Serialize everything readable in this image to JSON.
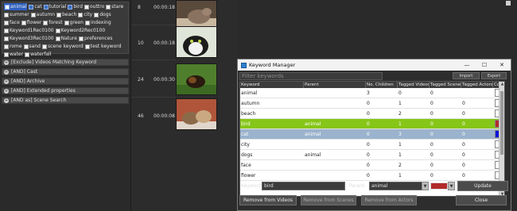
{
  "tags": [
    {
      "label": "animal",
      "checked": true,
      "highlight": true
    },
    {
      "label": "cat",
      "checked": true,
      "highlight": false
    },
    {
      "label": "tutorial",
      "checked": true,
      "highlight": false
    },
    {
      "label": "bird",
      "checked": true,
      "highlight": false
    },
    {
      "label": "outtro",
      "checked": false,
      "highlight": false
    },
    {
      "label": "stare",
      "checked": false,
      "highlight": false
    },
    {
      "label": "summer",
      "checked": false,
      "highlight": false
    },
    {
      "label": "autumn",
      "checked": false,
      "highlight": false
    },
    {
      "label": "beach",
      "checked": false,
      "highlight": false
    },
    {
      "label": "city",
      "checked": false,
      "highlight": false
    },
    {
      "label": "dogs",
      "checked": false,
      "highlight": false
    },
    {
      "label": "face",
      "checked": false,
      "highlight": false
    },
    {
      "label": "flower",
      "checked": false,
      "highlight": false
    },
    {
      "label": "forest",
      "checked": false,
      "highlight": false
    },
    {
      "label": "green",
      "checked": false,
      "highlight": false
    },
    {
      "label": "indexing",
      "checked": false,
      "highlight": false
    },
    {
      "label": "Keyword1Rec0100",
      "checked": false,
      "highlight": false
    },
    {
      "label": "Keyword2Rec0100",
      "checked": false,
      "highlight": false
    },
    {
      "label": "Keyword3Rec0100",
      "checked": false,
      "highlight": false
    },
    {
      "label": "Nature",
      "checked": false,
      "highlight": false
    },
    {
      "label": "preferences",
      "checked": false,
      "highlight": false
    },
    {
      "label": "rome",
      "checked": false,
      "highlight": false
    },
    {
      "label": "sand",
      "checked": false,
      "highlight": false
    },
    {
      "label": "scene keyword",
      "checked": false,
      "highlight": false
    },
    {
      "label": "test keyword",
      "checked": false,
      "highlight": false
    },
    {
      "label": "water",
      "checked": false,
      "highlight": false
    },
    {
      "label": "waterfall",
      "checked": false,
      "highlight": false
    }
  ],
  "filter_sections": [
    "[Exclude] Videos Matching Keyword",
    "[AND] Cast",
    "[AND] Archive",
    "[AND] Extended properties",
    "[AND as] Scene Search"
  ],
  "videos": [
    {
      "num": "8",
      "duration": "00:00:18"
    },
    {
      "num": "10",
      "duration": "00:00:18"
    },
    {
      "num": "24",
      "duration": "00:00:30"
    },
    {
      "num": "46",
      "duration": "00:00:08"
    }
  ],
  "keyword_manager": {
    "title": "Keyword Manager",
    "window_buttons": {
      "minimize": "—",
      "maximize": "☐",
      "close": "✕"
    },
    "filter_placeholder": "Filter keywords",
    "import_label": "Import",
    "export_label": "Export",
    "columns": [
      "Keyword",
      "Parent",
      "No. Children",
      "Tagged Videos",
      "Tagged Scenes",
      "Tagged Actors",
      "Color"
    ],
    "rows": [
      {
        "keyword": "animal",
        "parent": "",
        "children": "3",
        "videos": "0",
        "scenes": "0",
        "actors": "",
        "color": "#ffffff",
        "state": "normal"
      },
      {
        "keyword": "autumn",
        "parent": "",
        "children": "0",
        "videos": "1",
        "scenes": "0",
        "actors": "0",
        "color": "#ffffff",
        "state": "normal"
      },
      {
        "keyword": "beach",
        "parent": "",
        "children": "0",
        "videos": "2",
        "scenes": "0",
        "actors": "0",
        "color": "#ffffff",
        "state": "normal"
      },
      {
        "keyword": "bird",
        "parent": "animal",
        "children": "0",
        "videos": "1",
        "scenes": "0",
        "actors": "0",
        "color": "#b22a2a",
        "state": "green"
      },
      {
        "keyword": "cat",
        "parent": "animal",
        "children": "0",
        "videos": "3",
        "scenes": "0",
        "actors": "0",
        "color": "#0a14d8",
        "state": "blue"
      },
      {
        "keyword": "city",
        "parent": "",
        "children": "0",
        "videos": "1",
        "scenes": "0",
        "actors": "0",
        "color": "#ffffff",
        "state": "normal"
      },
      {
        "keyword": "dogs",
        "parent": "animal",
        "children": "0",
        "videos": "1",
        "scenes": "0",
        "actors": "0",
        "color": "#ffffff",
        "state": "normal"
      },
      {
        "keyword": "face",
        "parent": "",
        "children": "0",
        "videos": "2",
        "scenes": "0",
        "actors": "0",
        "color": "#ffffff",
        "state": "normal"
      },
      {
        "keyword": "flower",
        "parent": "",
        "children": "0",
        "videos": "1",
        "scenes": "0",
        "actors": "0",
        "color": "#ffffff",
        "state": "normal"
      }
    ],
    "form": {
      "keyword_label": "Keyword:",
      "keyword_value": "bird",
      "parent_label": "Parent:",
      "parent_value": "animal",
      "color": "#b22a2a",
      "update_label": "Update"
    },
    "buttons": {
      "remove_videos": "Remove from Videos",
      "remove_scenes": "Remove from Scenes",
      "remove_actors": "Remove from Actors",
      "close": "Close"
    }
  }
}
